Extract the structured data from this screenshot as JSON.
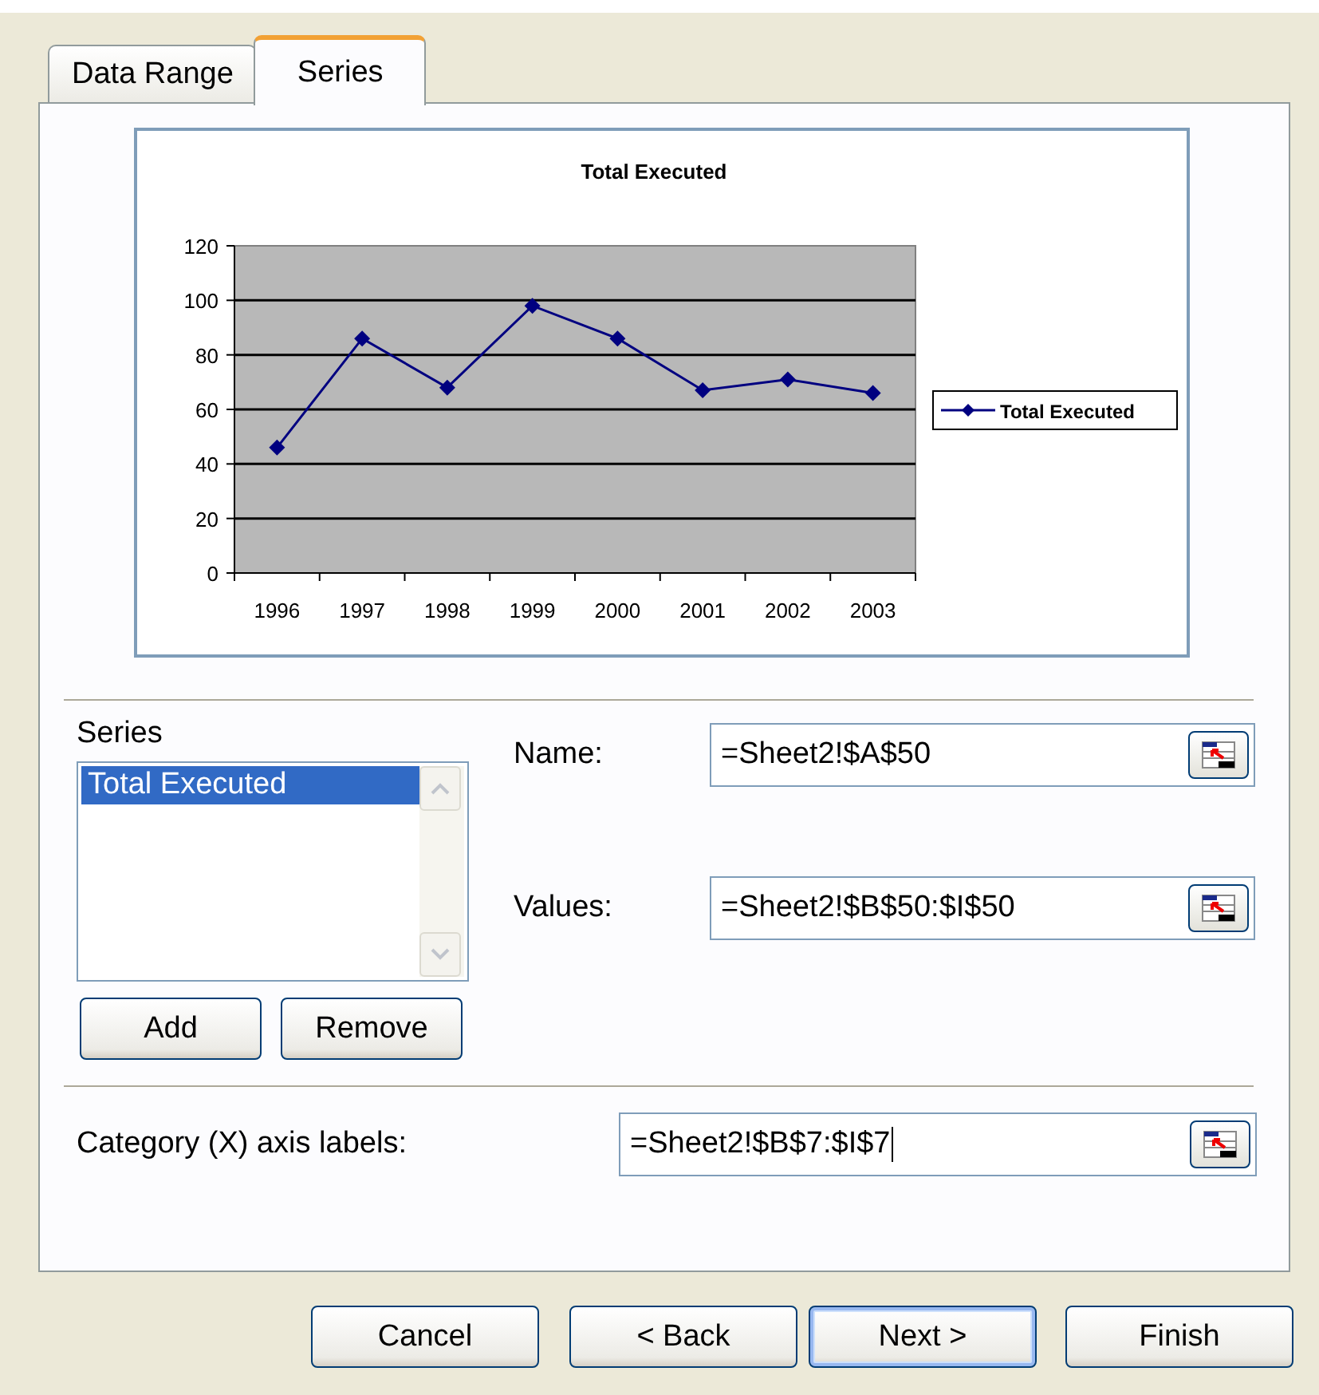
{
  "tabs": [
    {
      "label": "Data Range",
      "selected": false
    },
    {
      "label": "Series",
      "selected": true
    }
  ],
  "chart_preview": {
    "chart_data": {
      "type": "line",
      "title": "Total Executed",
      "categories": [
        "1996",
        "1997",
        "1998",
        "1999",
        "2000",
        "2001",
        "2002",
        "2003"
      ],
      "series": [
        {
          "name": "Total Executed",
          "color": "#000080",
          "marker": "diamond",
          "values": [
            46,
            86,
            68,
            98,
            86,
            67,
            71,
            66
          ]
        }
      ],
      "ylim": [
        0,
        120
      ],
      "yticks": [
        0,
        20,
        40,
        60,
        80,
        100,
        120
      ],
      "grid": true
    }
  },
  "series_list": {
    "label": "Series",
    "items": [
      {
        "label": "Total Executed",
        "selected": true
      }
    ]
  },
  "fields": [
    {
      "label": "Name:",
      "value": "=Sheet2!$A$50"
    },
    {
      "label": "Values:",
      "value": "=Sheet2!$B$50:$I$50"
    }
  ],
  "list_buttons": [
    "Add",
    "Remove"
  ],
  "category_field": {
    "label": "Category (X) axis labels:",
    "value": "=Sheet2!$B$7:$I$7",
    "focused": true
  },
  "buttons": [
    {
      "label": "Cancel",
      "default": false
    },
    {
      "label": "< Back",
      "default": false
    },
    {
      "label": "Next >",
      "default": true
    },
    {
      "label": "Finish",
      "default": false
    }
  ]
}
